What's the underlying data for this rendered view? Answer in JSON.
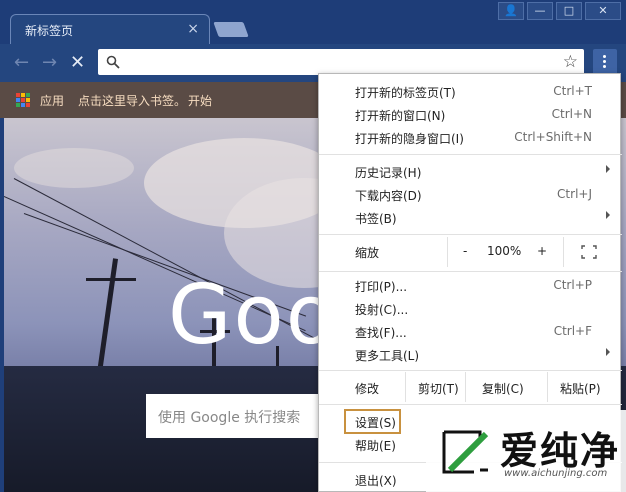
{
  "tab": {
    "title": "新标签页",
    "close": "×"
  },
  "window": {
    "user": "👤",
    "minimize": "—",
    "maximize": "□",
    "close": "✕"
  },
  "toolbar": {
    "back": "←",
    "forward": "→",
    "stop": "✕",
    "star": "☆"
  },
  "omnibox": {
    "value": "",
    "placeholder": ""
  },
  "bookmarks": {
    "apps": "应用",
    "import": "点击这里导入书签。",
    "start": "开始"
  },
  "page": {
    "logo": "Goo",
    "search_placeholder": "使用 Google 执行搜索"
  },
  "menu": {
    "new_tab": {
      "label": "打开新的标签页(T)",
      "shortcut": "Ctrl+T"
    },
    "new_window": {
      "label": "打开新的窗口(N)",
      "shortcut": "Ctrl+N"
    },
    "incognito": {
      "label": "打开新的隐身窗口(I)",
      "shortcut": "Ctrl+Shift+N"
    },
    "history": {
      "label": "历史记录(H)"
    },
    "downloads": {
      "label": "下载内容(D)",
      "shortcut": "Ctrl+J"
    },
    "bookmarks": {
      "label": "书签(B)"
    },
    "zoom": {
      "label": "缩放",
      "minus": "-",
      "value": "100%",
      "plus": "+"
    },
    "print": {
      "label": "打印(P)...",
      "shortcut": "Ctrl+P"
    },
    "cast": {
      "label": "投射(C)..."
    },
    "find": {
      "label": "查找(F)...",
      "shortcut": "Ctrl+F"
    },
    "more_tools": {
      "label": "更多工具(L)"
    },
    "edit": {
      "label": "修改",
      "cut": "剪切(T)",
      "copy": "复制(C)",
      "paste": "粘贴(P)"
    },
    "settings": {
      "label": "设置(S)"
    },
    "help": {
      "label": "帮助(E)"
    },
    "exit": {
      "label": "退出(X)"
    }
  },
  "watermark": {
    "brand": "爱纯净",
    "url": "www.aichunjing.com"
  },
  "colors": {
    "menu_highlight": "#c8913f",
    "bookmark_bar": "#5a4b45",
    "frame": "#1e3d78"
  }
}
